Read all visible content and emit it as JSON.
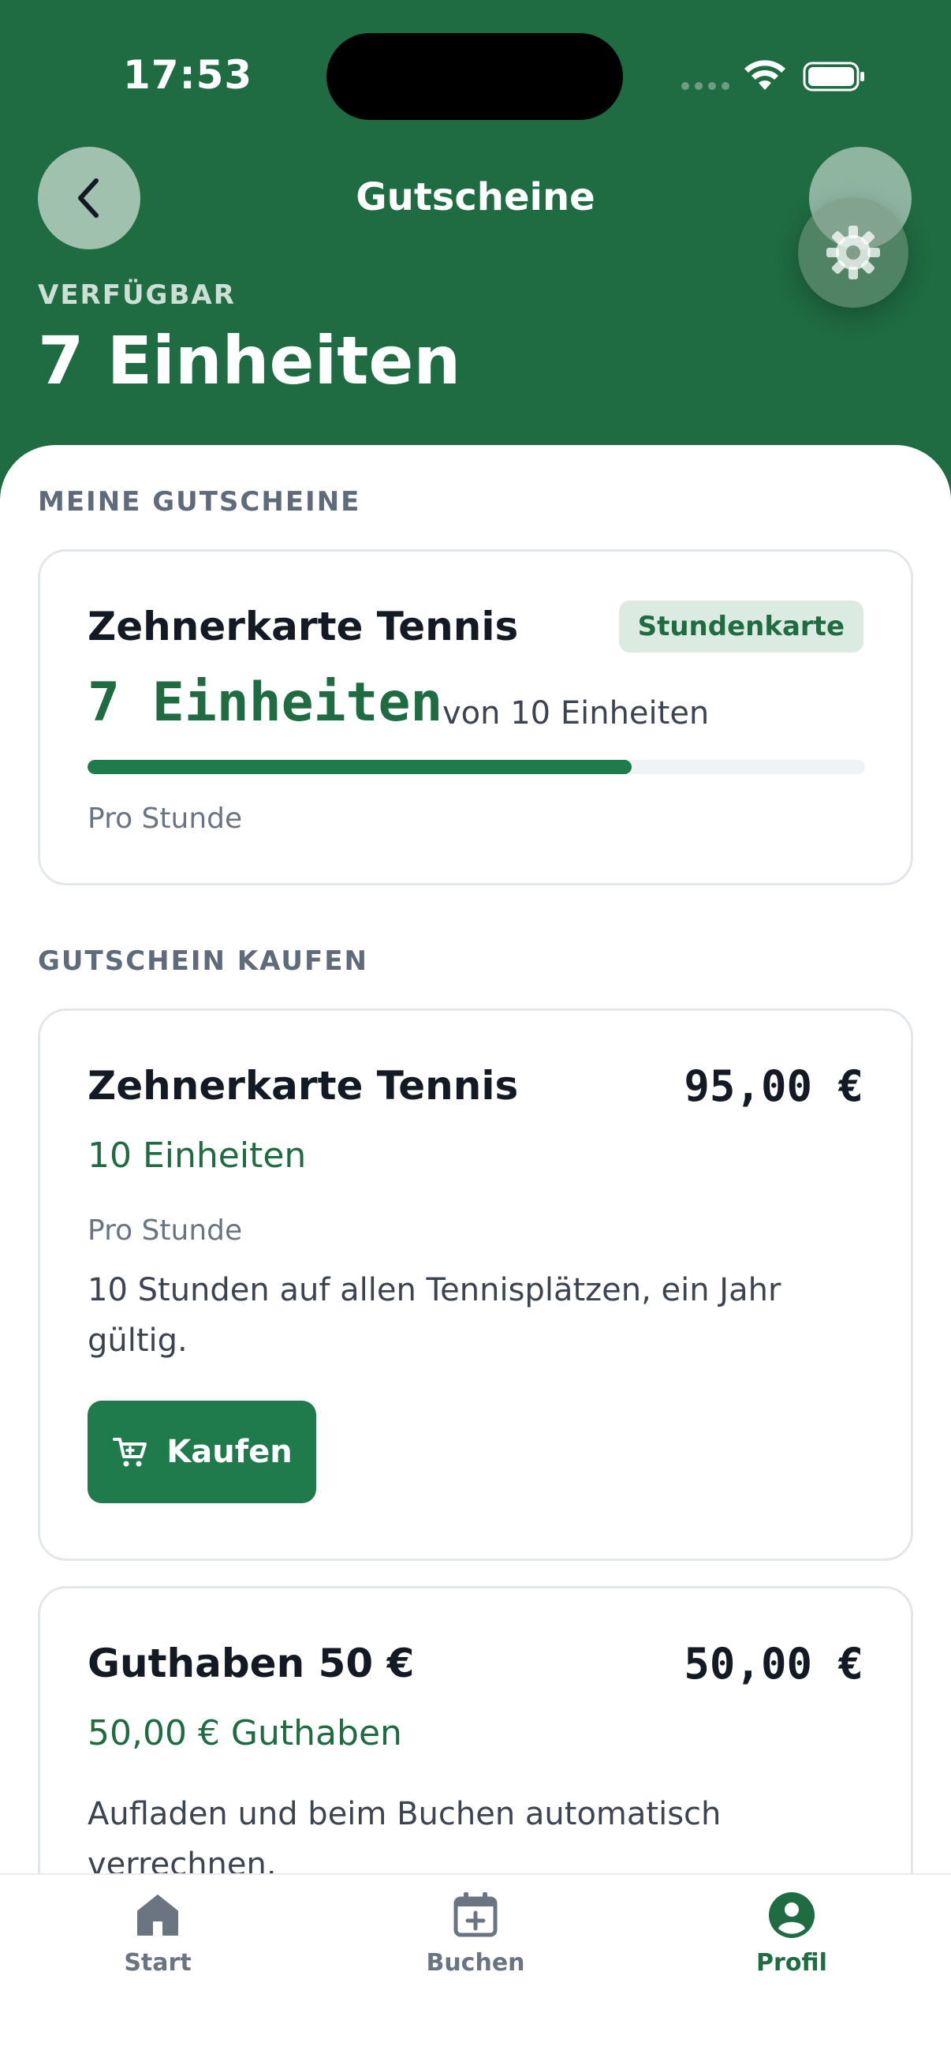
{
  "status_bar": {
    "time": "17:53"
  },
  "header": {
    "title": "Gutscheine",
    "available_label": "VERFÜGBAR",
    "available_value": "7 Einheiten"
  },
  "my_vouchers": {
    "section_label": "MEINE GUTSCHEINE",
    "items": [
      {
        "title": "Zehnerkarte Tennis",
        "badge": "Stundenkarte",
        "remaining": "7 Einheiten",
        "of_total": "von 10 Einheiten",
        "progress_fraction": 0.7,
        "unit": "Pro Stunde"
      }
    ]
  },
  "buy_vouchers": {
    "section_label": "GUTSCHEIN KAUFEN",
    "items": [
      {
        "title": "Zehnerkarte Tennis",
        "price": "95,00 €",
        "subtitle": "10 Einheiten",
        "unit": "Pro Stunde",
        "description": "10 Stunden auf allen Tennisplätzen, ein Jahr gültig.",
        "button_label": "Kaufen"
      },
      {
        "title": "Guthaben 50 €",
        "price": "50,00 €",
        "subtitle": "50,00 € Guthaben",
        "description": "Aufladen und beim Buchen automatisch verrechnen."
      }
    ]
  },
  "tabbar": {
    "items": [
      {
        "label": "Start",
        "icon": "home-icon",
        "active": false
      },
      {
        "label": "Buchen",
        "icon": "calendar-plus-icon",
        "active": false
      },
      {
        "label": "Profil",
        "icon": "user-circle-icon",
        "active": true
      }
    ]
  },
  "colors": {
    "brand_green": "#1f6b42",
    "accent_green": "#1f7a4c",
    "badge_bg": "#dcebe1"
  }
}
